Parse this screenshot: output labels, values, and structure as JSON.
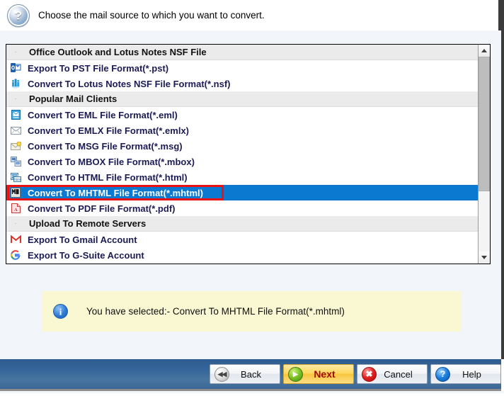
{
  "header": {
    "icon": "question-help-icon",
    "instruction": "Choose the mail source to which you want to convert."
  },
  "list": {
    "rows": [
      {
        "type": "group",
        "label": "Office Outlook and Lotus Notes NSF File",
        "icon": "group-marker-icon"
      },
      {
        "type": "item",
        "label": "Export To PST File Format(*.pst)",
        "icon": "outlook-pst-icon",
        "selected": false
      },
      {
        "type": "item",
        "label": "Convert To Lotus Notes NSF File Format(*.nsf)",
        "icon": "lotus-notes-nsf-icon",
        "selected": false
      },
      {
        "type": "group",
        "label": "Popular Mail Clients",
        "icon": "group-marker-icon"
      },
      {
        "type": "item",
        "label": "Convert To EML File Format(*.eml)",
        "icon": "eml-file-icon",
        "selected": false
      },
      {
        "type": "item",
        "label": "Convert To EMLX File Format(*.emlx)",
        "icon": "emlx-envelope-icon",
        "selected": false
      },
      {
        "type": "item",
        "label": "Convert To MSG File Format(*.msg)",
        "icon": "msg-envelope-icon",
        "selected": false
      },
      {
        "type": "item",
        "label": "Convert To MBOX File Format(*.mbox)",
        "icon": "mbox-file-icon",
        "selected": false
      },
      {
        "type": "item",
        "label": "Convert To HTML File Format(*.html)",
        "icon": "html-file-icon",
        "selected": false
      },
      {
        "type": "item",
        "label": "Convert To MHTML File Format(*.mhtml)",
        "icon": "mhtml-file-icon",
        "selected": true
      },
      {
        "type": "item",
        "label": "Convert To PDF File Format(*.pdf)",
        "icon": "pdf-file-icon",
        "selected": false
      },
      {
        "type": "group",
        "label": "Upload To Remote Servers",
        "icon": "group-marker-icon"
      },
      {
        "type": "item",
        "label": "Export To Gmail Account",
        "icon": "gmail-icon",
        "selected": false
      },
      {
        "type": "item",
        "label": "Export To G-Suite Account",
        "icon": "g-suite-icon",
        "selected": false
      }
    ],
    "scrollbar": {
      "up_arrow": "scroll-up-arrow-icon",
      "down_arrow": "scroll-down-arrow-icon",
      "thumb_position_percent": 0,
      "thumb_size_percent": 69
    },
    "selection_highlight_color": "#0b79d0",
    "marker_box_color": "#ee1111"
  },
  "info": {
    "icon": "information-icon",
    "message": "You have selected:- Convert To MHTML File Format(*.mhtml)",
    "background_color": "#faf8d2"
  },
  "footer": {
    "background_color": "#35659b",
    "buttons": [
      {
        "label": "Back",
        "icon": "rewind-back-icon",
        "symbol": "◀◀",
        "style": "normal"
      },
      {
        "label": "Next",
        "icon": "play-next-icon",
        "symbol": "▶",
        "style": "primary"
      },
      {
        "label": "Cancel",
        "icon": "cancel-cross-icon",
        "symbol": "✖",
        "style": "normal"
      },
      {
        "label": "Help",
        "icon": "help-question-icon",
        "symbol": "?",
        "style": "normal"
      }
    ]
  }
}
